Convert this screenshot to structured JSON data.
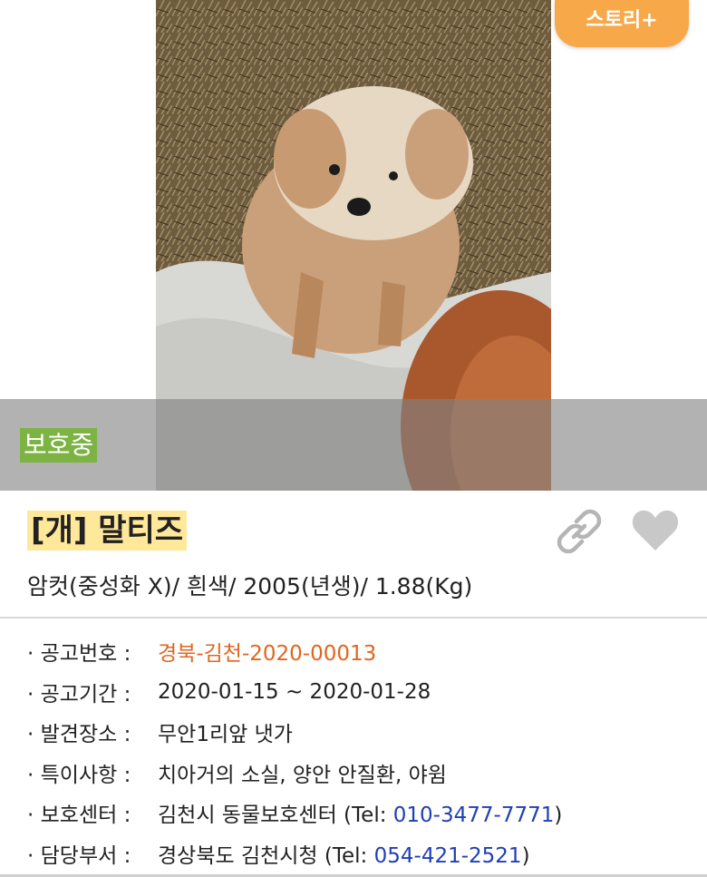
{
  "story_button": "스토리+",
  "status_badge": "보호중",
  "title": "[개] 말티즈",
  "subtitle": "암컷(중성화 X)/ 흰색/ 2005(년생)/ 1.88(Kg)",
  "icons": {
    "link": "link-icon",
    "favorite": "heart-icon"
  },
  "colors": {
    "story": "#f7a94a",
    "badge": "#7cb342",
    "title_highlight": "#ffe89a",
    "notice_number": "#e0661f",
    "tel": "#1f3fb5"
  },
  "info": [
    {
      "label": "· 공고번호 :",
      "value": "경북-김천-2020-00013"
    },
    {
      "label": "· 공고기간 :",
      "value": "2020-01-15 ~ 2020-01-28"
    },
    {
      "label": "· 발견장소 :",
      "value": "무안1리앞 냇가"
    },
    {
      "label": "· 특이사항 :",
      "value": "치아거의 소실, 양안 안질환, 야윔"
    },
    {
      "label": "· 보호센터 :",
      "value_prefix": "김천시 동물보호센터 (Tel: ",
      "tel": "010-3477-7771",
      "value_suffix": ")"
    },
    {
      "label": "· 담당부서 :",
      "value_prefix": "경상북도 김천시청 (Tel: ",
      "tel": "054-421-2521",
      "value_suffix": ")"
    }
  ]
}
